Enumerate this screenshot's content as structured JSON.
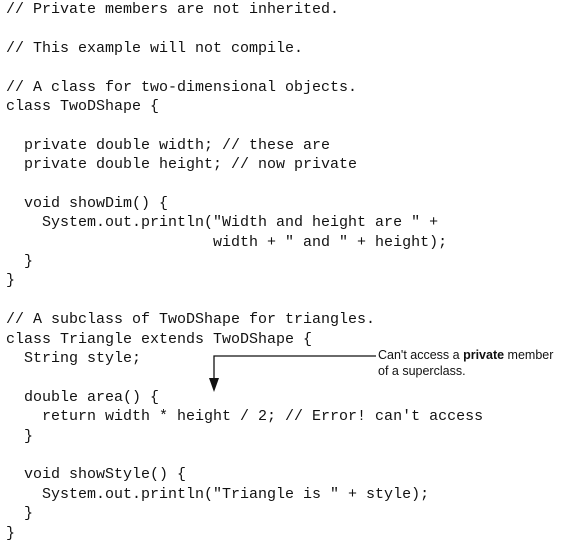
{
  "code": {
    "lines": [
      "// Private members are not inherited.",
      "",
      "// This example will not compile.",
      "",
      "// A class for two-dimensional objects.",
      "class TwoDShape {",
      "",
      "  private double width; // these are",
      "  private double height; // now private",
      "",
      "  void showDim() {",
      "    System.out.println(\"Width and height are \" +",
      "                       width + \" and \" + height);",
      "  }",
      "}",
      "",
      "// A subclass of TwoDShape for triangles.",
      "class Triangle extends TwoDShape {",
      "  String style;",
      "",
      "  double area() {",
      "    return width * height / 2; // Error! can't access",
      "  }",
      "",
      "  void showStyle() {",
      "    System.out.println(\"Triangle is \" + style);",
      "  }",
      "}"
    ]
  },
  "callout": {
    "text_before": "Can't access a ",
    "bold_word": "private",
    "text_after": " member",
    "line2": "of a superclass."
  }
}
